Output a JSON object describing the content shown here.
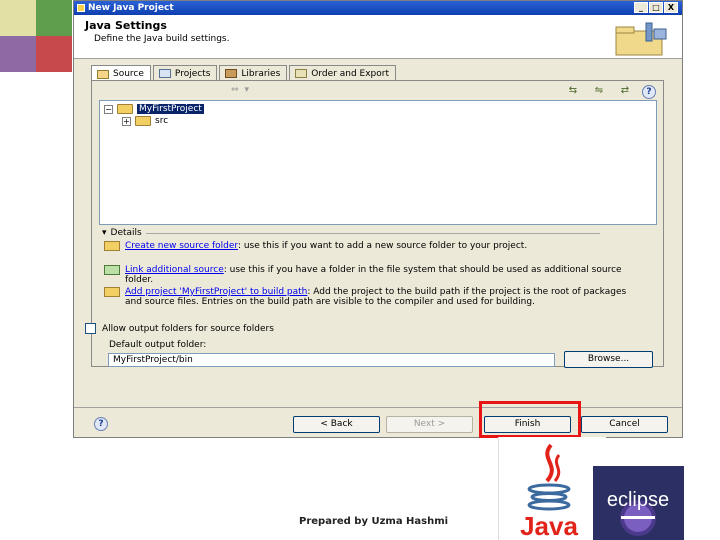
{
  "colors": {
    "accent_red": "#e81515",
    "title_blue": "#0f3fb0",
    "selection": "#0a246a",
    "link": "#0000ee"
  },
  "window": {
    "title": "New Java Project",
    "buttons": [
      "_",
      "□",
      "X"
    ]
  },
  "banner": {
    "title": "Java Settings",
    "description": "Define the Java build settings.",
    "icon": "folder-wizard-icon"
  },
  "tabs": [
    {
      "label": "Source",
      "icon": "source-folder-icon",
      "active": true
    },
    {
      "label": "Projects",
      "icon": "projects-icon",
      "active": false
    },
    {
      "label": "Libraries",
      "icon": "libraries-icon",
      "active": false
    },
    {
      "label": "Order and Export",
      "icon": "order-export-icon",
      "active": false
    }
  ],
  "tree": {
    "project": "MyFirstProject",
    "child": "src"
  },
  "details": {
    "heading": "Details",
    "items": [
      {
        "link": "Create new source folder",
        "text": ": use this if you want to add a new source folder to your project."
      },
      {
        "link": "Link additional source",
        "text": ": use this if you have a folder in the file system that should be used as additional source folder."
      },
      {
        "link": "Add project 'MyFirstProject' to build path",
        "text": ": Add the project to the build path if the project is the root of packages and source files. Entries on the build path are visible to the compiler and used for building."
      }
    ]
  },
  "output": {
    "checkbox_label": "Allow output folders for source folders",
    "label": "Default output folder:",
    "value": "MyFirstProject/bin",
    "browse_label": "Browse..."
  },
  "footer": {
    "help_glyph": "?",
    "back_label": "< Back",
    "next_label": "Next >",
    "finish_label": "Finish",
    "cancel_label": "Cancel"
  },
  "credit": "Prepared by Uzma Hashmi",
  "logos": {
    "java": "Java",
    "eclipse": "eclipse"
  }
}
